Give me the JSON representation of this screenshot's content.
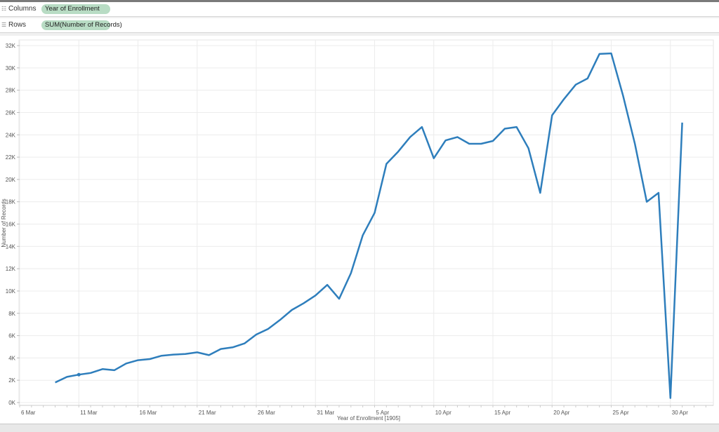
{
  "shelves": {
    "columns_label": "Columns",
    "columns_pill": "Year of Enrollment",
    "rows_label": "Rows",
    "rows_pill": "SUM(Number of Records)"
  },
  "colors": {
    "line": "#2e7ebc",
    "grid": "#ececec"
  },
  "chart_data": {
    "type": "line",
    "title": "",
    "xlabel": "Year of Enrollment [1905]",
    "ylabel": "Number of Records",
    "ylim": [
      0,
      32000
    ],
    "yticks": [
      "0K",
      "2K",
      "4K",
      "6K",
      "8K",
      "10K",
      "12K",
      "14K",
      "16K",
      "18K",
      "20K",
      "22K",
      "24K",
      "26K",
      "28K",
      "30K",
      "32K"
    ],
    "xticks": [
      "6 Mar",
      "11 Mar",
      "16 Mar",
      "21 Mar",
      "26 Mar",
      "31 Mar",
      "5 Apr",
      "10 Apr",
      "15 Apr",
      "20 Apr",
      "25 Apr",
      "30 Apr"
    ],
    "x_start": "6 Mar",
    "x_end_days": 58,
    "first_point_day": 3,
    "highlight_day": 5,
    "grid": true,
    "series": [
      {
        "name": "SUM(Number of Records)",
        "values": [
          1800,
          2300,
          2500,
          2650,
          3000,
          2900,
          3500,
          3800,
          3900,
          4200,
          4300,
          4350,
          4500,
          4250,
          4800,
          4950,
          5300,
          6100,
          6600,
          7400,
          8300,
          8900,
          9600,
          10550,
          9300,
          11600,
          15000,
          17000,
          21400,
          22500,
          23800,
          24700,
          21900,
          23500,
          23800,
          23200,
          23200,
          23450,
          24550,
          24700,
          22800,
          18800,
          25750,
          27200,
          28500,
          29050,
          31250,
          31300,
          27500,
          23200,
          18000,
          18800,
          400,
          25100
        ]
      }
    ]
  }
}
